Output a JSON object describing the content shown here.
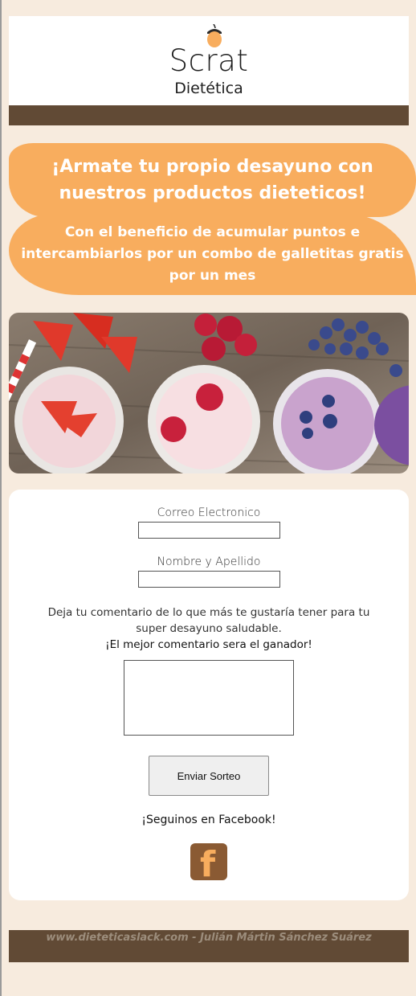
{
  "brand": {
    "name": "Scrat",
    "subtitle": "Dietética"
  },
  "promo": {
    "headline": "¡Armate tu propio desayuno con nuestros productos dieteticos!",
    "benefit": "Con el beneficio de acumular puntos e intercambiarlos por un combo de galletitas gratis por un mes"
  },
  "form": {
    "email_label": "Correo Electronico",
    "email_value": "",
    "name_label": "Nombre y Apellido",
    "name_value": "",
    "comment_prompt": "Deja tu comentario de lo que más te gustaría tener para tu super desayuno saludable.",
    "comment_highlight": "¡El mejor comentario sera el ganador!",
    "comment_value": "",
    "submit_label": "Enviar Sorteo",
    "follow_text": "¡Seguinos en Facebook!",
    "facebook_icon": "facebook-icon"
  },
  "footer": {
    "text": "www.dieteticaslack.com - Julián Mártin Sánchez Suárez"
  },
  "colors": {
    "background": "#f7ebde",
    "accent_orange": "#f8ad5e",
    "brand_brown": "#614a35"
  }
}
